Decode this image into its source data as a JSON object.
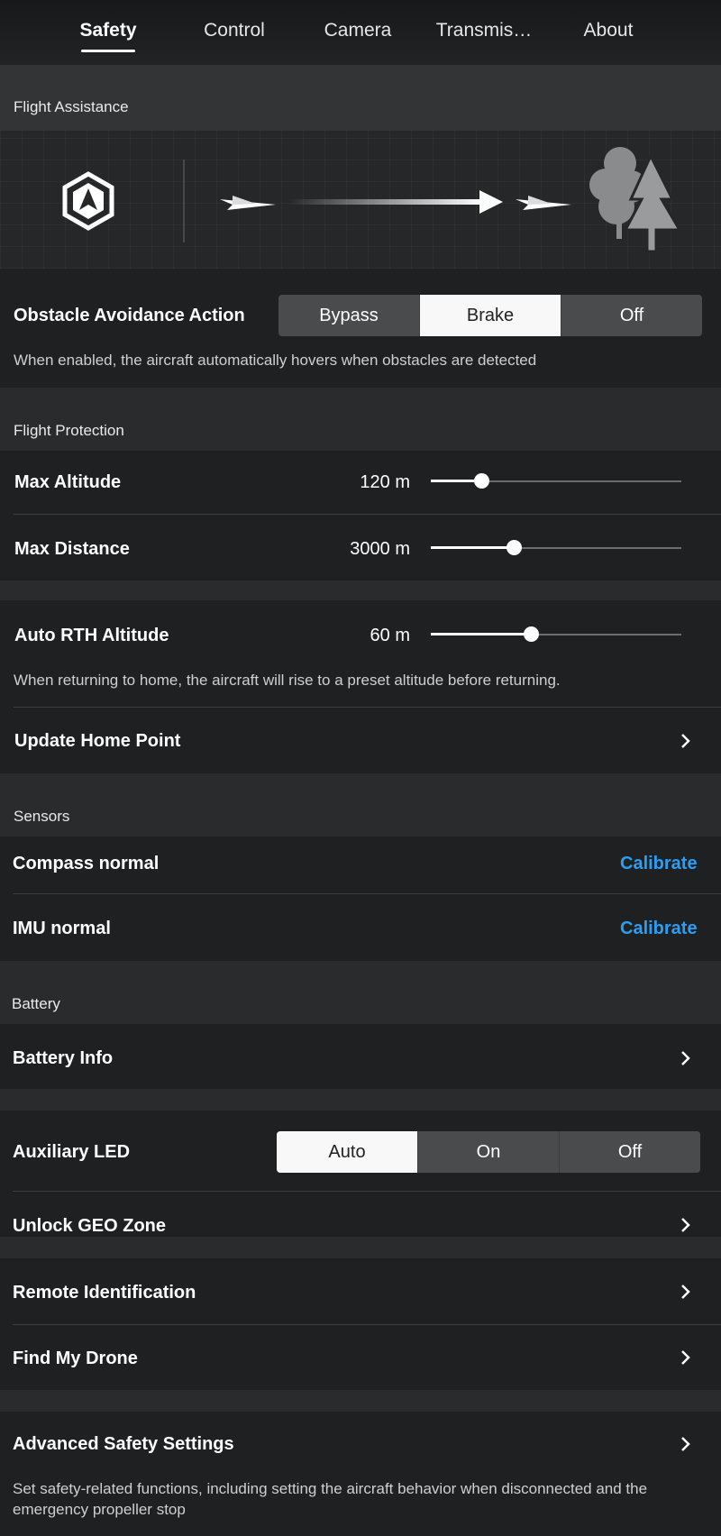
{
  "tabs": [
    {
      "label": "Safety",
      "active": true
    },
    {
      "label": "Control",
      "active": false
    },
    {
      "label": "Camera",
      "active": false
    },
    {
      "label": "Transmis…",
      "active": false
    },
    {
      "label": "About",
      "active": false
    }
  ],
  "flight_assistance": {
    "section_title": "Flight Assistance",
    "obstacle_label": "Obstacle Avoidance Action",
    "obstacle_options": [
      "Bypass",
      "Brake",
      "Off"
    ],
    "obstacle_selected": "Brake",
    "obstacle_desc": "When enabled, the aircraft automatically hovers when obstacles are detected"
  },
  "flight_protection": {
    "section_title": "Flight Protection",
    "max_altitude_label": "Max Altitude",
    "max_altitude_value": "120 m",
    "max_altitude_fraction": 0.2,
    "max_distance_label": "Max Distance",
    "max_distance_value": "3000 m",
    "max_distance_fraction": 0.33,
    "rth_label": "Auto RTH Altitude",
    "rth_value": "60 m",
    "rth_fraction": 0.4,
    "rth_desc": "When returning to home, the aircraft will rise to a preset altitude before returning.",
    "update_home_label": "Update Home Point"
  },
  "sensors": {
    "section_title": "Sensors",
    "compass_label": "Compass normal",
    "compass_action": "Calibrate",
    "imu_label": "IMU normal",
    "imu_action": "Calibrate"
  },
  "battery": {
    "section_title": "Battery",
    "info_label": "Battery Info"
  },
  "misc": {
    "aux_led_label": "Auxiliary LED",
    "aux_led_options": [
      "Auto",
      "On",
      "Off"
    ],
    "aux_led_selected": "Auto",
    "unlock_geo_label": "Unlock GEO Zone",
    "remote_id_label": "Remote Identification",
    "find_drone_label": "Find My Drone",
    "advanced_label": "Advanced Safety Settings",
    "advanced_desc": "Set safety-related functions, including setting the aircraft behavior when disconnected and the emergency propeller stop"
  },
  "colors": {
    "accent": "#2a9df4",
    "background": "#2b2c2e",
    "row_background": "#1f2022"
  }
}
